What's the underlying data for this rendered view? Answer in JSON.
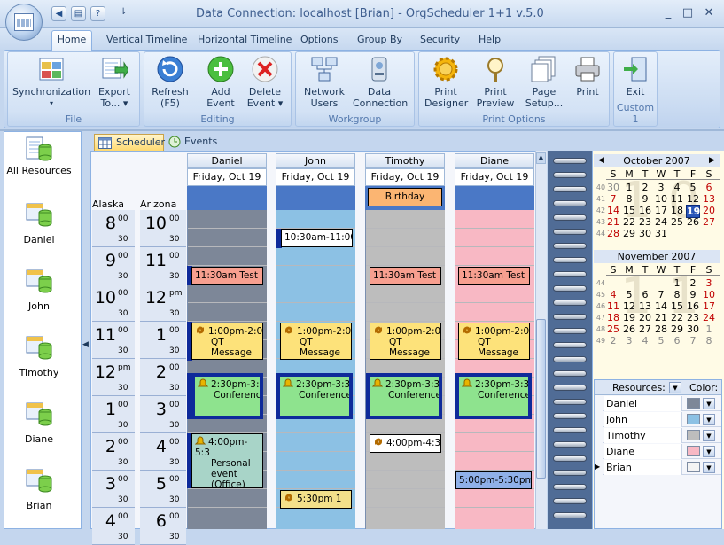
{
  "window": {
    "title": "Data Connection: localhost [Brian] - OrgScheduler 1+1 v.5.0",
    "minimize": "_",
    "maximize": "□",
    "close": "✕"
  },
  "quick_access": {
    "more": "⇂"
  },
  "ribbon_tabs": [
    "Home",
    "Vertical Timeline",
    "Horizontal Timeline",
    "Options",
    "Group By",
    "Security",
    "Help"
  ],
  "ribbon": {
    "groups": [
      {
        "title": "File",
        "buttons": [
          {
            "label1": "Synchronization",
            "label2": "▾"
          },
          {
            "label1": "Export",
            "label2": "To... ▾"
          }
        ]
      },
      {
        "title": "Editing",
        "buttons": [
          {
            "label1": "Refresh",
            "label2": "(F5)"
          },
          {
            "label1": "Add",
            "label2": "Event"
          },
          {
            "label1": "Delete",
            "label2": "Event ▾"
          }
        ]
      },
      {
        "title": "Workgroup",
        "buttons": [
          {
            "label1": "Network",
            "label2": "Users"
          },
          {
            "label1": "Data",
            "label2": "Connection"
          }
        ]
      },
      {
        "title": "Print Options",
        "buttons": [
          {
            "label1": "Print",
            "label2": "Designer"
          },
          {
            "label1": "Print",
            "label2": "Preview"
          },
          {
            "label1": "Page",
            "label2": "Setup..."
          },
          {
            "label1": "Print",
            "label2": ""
          }
        ]
      },
      {
        "title": "Custom 1",
        "buttons": [
          {
            "label1": "Exit",
            "label2": ""
          }
        ]
      }
    ]
  },
  "resources_panel": {
    "all_label": "All Resources",
    "items": [
      "Daniel",
      "John",
      "Timothy",
      "Diane",
      "Brian"
    ]
  },
  "view_tabs": {
    "scheduler": "Scheduler",
    "events": "Events"
  },
  "timezones": {
    "left": "Alaska",
    "right": "Arizona"
  },
  "hours": [
    {
      "a": "8",
      "as": "00",
      "b": "10",
      "bs": "00"
    },
    {
      "a": "9",
      "as": "00",
      "b": "11",
      "bs": "00"
    },
    {
      "a": "10",
      "as": "00",
      "b": "12",
      "bs": "pm"
    },
    {
      "a": "11",
      "as": "00",
      "b": "1",
      "bs": "00"
    },
    {
      "a": "12",
      "as": "pm",
      "b": "2",
      "bs": "00"
    },
    {
      "a": "1",
      "as": "00",
      "b": "3",
      "bs": "00"
    },
    {
      "a": "2",
      "as": "00",
      "b": "4",
      "bs": "00"
    },
    {
      "a": "3",
      "as": "00",
      "b": "5",
      "bs": "00"
    },
    {
      "a": "4",
      "as": "00",
      "b": "6",
      "bs": "00"
    }
  ],
  "half_label": "30",
  "columns": [
    {
      "name": "Daniel",
      "date": "Friday, Oct 19",
      "bg": "#7d8798"
    },
    {
      "name": "John",
      "date": "Friday, Oct 19",
      "bg": "#8cc1e4"
    },
    {
      "name": "Timothy",
      "date": "Friday, Oct 19",
      "bg": "#bdbdbd"
    },
    {
      "name": "Diane",
      "date": "Friday, Oct 19",
      "bg": "#f8b8c4"
    }
  ],
  "all_day": {
    "timothy": "Birthday"
  },
  "events": {
    "daniel_test": "11:30am Test",
    "daniel_qt": {
      "line1": "1:00pm-2:0",
      "line2": "QT",
      "line3": "Message"
    },
    "daniel_conf": {
      "line1": "2:30pm-3:3",
      "line2": "Conference"
    },
    "daniel_personal": {
      "line1": "4:00pm-5:3",
      "line2": "Personal",
      "line3": "event",
      "line4": "(Office)"
    },
    "john_1030": "10:30am-11:00",
    "john_qt": {
      "line1": "1:00pm-2:0",
      "line2": "QT",
      "line3": "Message"
    },
    "john_conf": {
      "line1": "2:30pm-3:3",
      "line2": "Conference"
    },
    "john_530": "5:30pm 1",
    "timothy_test": "11:30am Test",
    "timothy_qt": {
      "line1": "1:00pm-2:0",
      "line2": "QT",
      "line3": "Message"
    },
    "timothy_conf": {
      "line1": "2:30pm-3:3",
      "line2": "Conference"
    },
    "timothy_400": "4:00pm-4:3",
    "diane_test": "11:30am Test",
    "diane_qt": {
      "line1": "1:00pm-2:0",
      "line2": "QT",
      "line3": "Message"
    },
    "diane_conf": {
      "line1": "2:30pm-3:3",
      "line2": "Conference"
    },
    "diane_500": "5:00pm-5:30pm"
  },
  "calendar": {
    "days_of_week": [
      "S",
      "M",
      "T",
      "W",
      "T",
      "F",
      "S"
    ],
    "months": [
      {
        "title": "October 2007",
        "nav_prev": "◀",
        "nav_next": "▶",
        "watermark": "10",
        "weeks": [
          {
            "wk": "40",
            "days": [
              "30",
              "1",
              "2",
              "3",
              "4",
              "5",
              "6"
            ]
          },
          {
            "wk": "41",
            "days": [
              "7",
              "8",
              "9",
              "10",
              "11",
              "12",
              "13"
            ]
          },
          {
            "wk": "42",
            "days": [
              "14",
              "15",
              "16",
              "17",
              "18",
              "19",
              "20"
            ]
          },
          {
            "wk": "43",
            "days": [
              "21",
              "22",
              "23",
              "24",
              "25",
              "26",
              "27"
            ]
          },
          {
            "wk": "44",
            "days": [
              "28",
              "29",
              "30",
              "31",
              "",
              "",
              ""
            ]
          }
        ]
      },
      {
        "title": "November 2007",
        "watermark": "11",
        "weeks": [
          {
            "wk": "44",
            "days": [
              "",
              "",
              "",
              "",
              "1",
              "2",
              "3"
            ]
          },
          {
            "wk": "45",
            "days": [
              "4",
              "5",
              "6",
              "7",
              "8",
              "9",
              "10"
            ]
          },
          {
            "wk": "46",
            "days": [
              "11",
              "12",
              "13",
              "14",
              "15",
              "16",
              "17"
            ]
          },
          {
            "wk": "47",
            "days": [
              "18",
              "19",
              "20",
              "21",
              "22",
              "23",
              "24"
            ]
          },
          {
            "wk": "48",
            "days": [
              "25",
              "26",
              "27",
              "28",
              "29",
              "30",
              "1"
            ]
          },
          {
            "wk": "49",
            "days": [
              "2",
              "3",
              "4",
              "5",
              "6",
              "7",
              "8"
            ]
          }
        ]
      }
    ]
  },
  "resource_colors": {
    "header_resources": "Resources:",
    "header_color": "Color:",
    "rows": [
      {
        "name": "Daniel",
        "color": "#7d8798"
      },
      {
        "name": "John",
        "color": "#8cc1e4"
      },
      {
        "name": "Timothy",
        "color": "#bdbdbd"
      },
      {
        "name": "Diane",
        "color": "#f8b8c4"
      },
      {
        "name": "Brian",
        "color": "#f4f4f4"
      }
    ]
  },
  "colors": {
    "test_event": "#f79f8f",
    "qt_event": "#fde27a",
    "conf_event": "#8ee38e",
    "personal_event": "#a8d4c8",
    "timed_event": "#ffffff",
    "diane_evt": "#8fb0e8",
    "john_530": "#f3e08a"
  }
}
